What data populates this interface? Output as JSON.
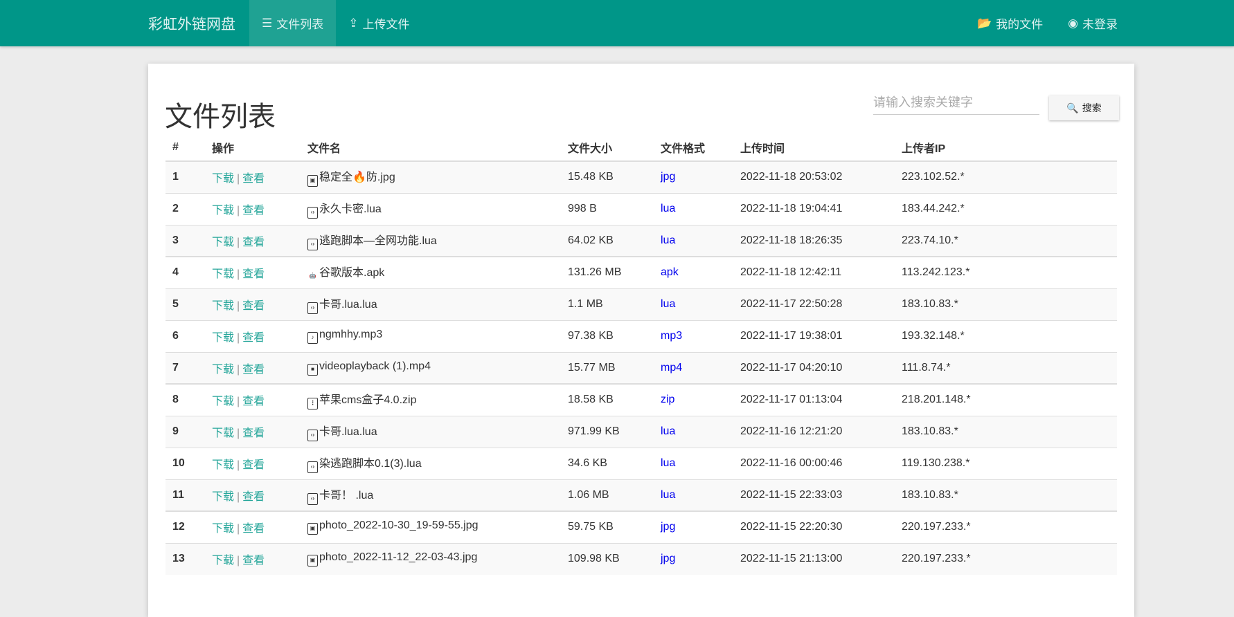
{
  "nav": {
    "brand": "彩虹外链网盘",
    "items": [
      {
        "label": "文件列表",
        "icon": "list-icon",
        "active": true
      },
      {
        "label": "上传文件",
        "icon": "upload-icon"
      }
    ],
    "right": [
      {
        "label": "我的文件",
        "icon": "folder-open-icon"
      },
      {
        "label": "未登录",
        "icon": "user-circle-icon"
      }
    ]
  },
  "page": {
    "title": "文件列表",
    "search_placeholder": "请输入搜索关键字",
    "search_button": "搜索"
  },
  "table": {
    "headers": [
      "#",
      "操作",
      "文件名",
      "文件大小",
      "文件格式",
      "上传时间",
      "上传者IP"
    ],
    "download_label": "下载",
    "view_label": "查看",
    "separator": "|",
    "rows": [
      {
        "n": "1",
        "icon": "image",
        "name": "稳定全🔥防.jpg",
        "size": "15.48 KB",
        "fmt": "jpg",
        "time": "2022-11-18 20:53:02",
        "ip": "223.102.52.*"
      },
      {
        "n": "2",
        "icon": "code",
        "name": "永久卡密.lua",
        "size": "998 B",
        "fmt": "lua",
        "time": "2022-11-18 19:04:41",
        "ip": "183.44.242.*"
      },
      {
        "n": "3",
        "icon": "code",
        "name": "逃跑脚本—全网功能.lua",
        "size": "64.02 KB",
        "fmt": "lua",
        "time": "2022-11-18 18:26:35",
        "ip": "223.74.10.*"
      },
      {
        "n": "4",
        "icon": "android",
        "name": "谷歌版本.apk",
        "size": "131.26 MB",
        "fmt": "apk",
        "time": "2022-11-18 12:42:11",
        "ip": "113.242.123.*"
      },
      {
        "n": "5",
        "icon": "code",
        "name": "卡哥.lua.lua",
        "size": "1.1 MB",
        "fmt": "lua",
        "time": "2022-11-17 22:50:28",
        "ip": "183.10.83.*"
      },
      {
        "n": "6",
        "icon": "audio",
        "name": "ngmhhy.mp3",
        "size": "97.38 KB",
        "fmt": "mp3",
        "time": "2022-11-17 19:38:01",
        "ip": "193.32.148.*"
      },
      {
        "n": "7",
        "icon": "video",
        "name": "videoplayback (1).mp4",
        "size": "15.77 MB",
        "fmt": "mp4",
        "time": "2022-11-17 04:20:10",
        "ip": "111.8.74.*"
      },
      {
        "n": "8",
        "icon": "archive",
        "name": "苹果cms盒子4.0.zip",
        "size": "18.58 KB",
        "fmt": "zip",
        "time": "2022-11-17 01:13:04",
        "ip": "218.201.148.*"
      },
      {
        "n": "9",
        "icon": "code",
        "name": "卡哥.lua.lua",
        "size": "971.99 KB",
        "fmt": "lua",
        "time": "2022-11-16 12:21:20",
        "ip": "183.10.83.*"
      },
      {
        "n": "10",
        "icon": "code",
        "name": "染逃跑脚本0.1(3).lua",
        "size": "34.6 KB",
        "fmt": "lua",
        "time": "2022-11-16 00:00:46",
        "ip": "119.130.238.*"
      },
      {
        "n": "11",
        "icon": "code",
        "name": "卡哥！ .lua",
        "size": "1.06 MB",
        "fmt": "lua",
        "time": "2022-11-15 22:33:03",
        "ip": "183.10.83.*"
      },
      {
        "n": "12",
        "icon": "image",
        "name": "photo_2022-10-30_19-59-55.jpg",
        "size": "59.75 KB",
        "fmt": "jpg",
        "time": "2022-11-15 22:20:30",
        "ip": "220.197.233.*"
      },
      {
        "n": "13",
        "icon": "image",
        "name": "photo_2022-11-12_22-03-43.jpg",
        "size": "109.98 KB",
        "fmt": "jpg",
        "time": "2022-11-15 21:13:00",
        "ip": "220.197.233.*"
      }
    ]
  },
  "colors": {
    "primary": "#009688",
    "link": "#26a69a",
    "format": "#0000ee"
  }
}
